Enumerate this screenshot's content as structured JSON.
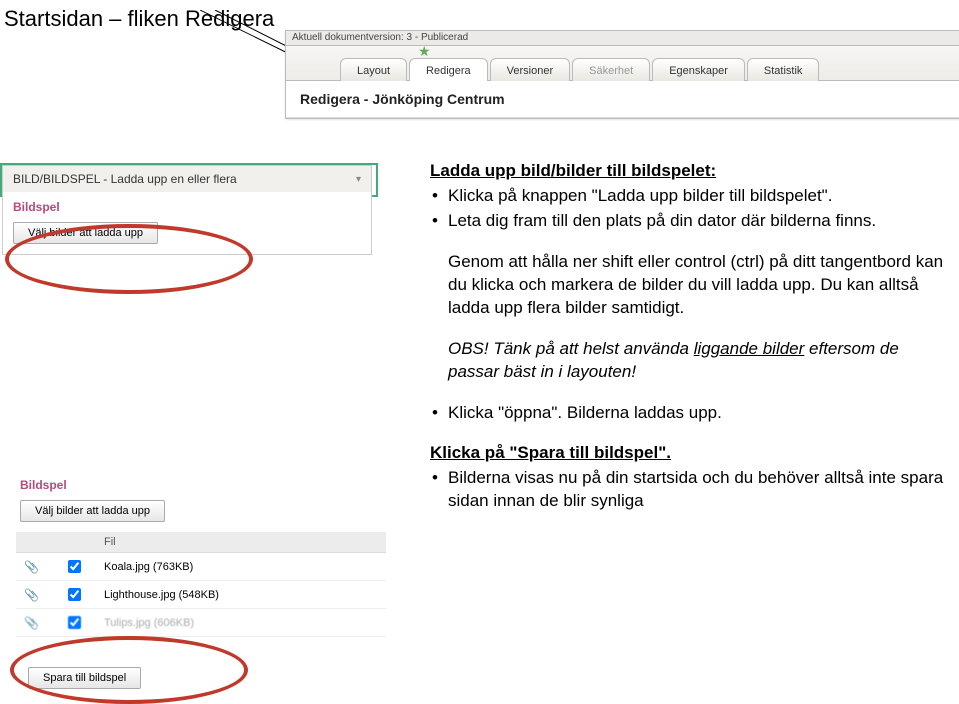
{
  "page_title": "Startsidan – fliken Redigera",
  "top_bar": {
    "doc_version": "Aktuell dokumentversion:  3  -  Publicerad",
    "tabs": [
      "Layout",
      "Redigera",
      "Versioner",
      "Säkerhet",
      "Egenskaper",
      "Statistik"
    ],
    "edit_header": "Redigera - Jönköping Centrum"
  },
  "panel1": {
    "title": "BILD/BILDSPEL - Ladda upp en eller flera",
    "subheading": "Bildspel",
    "upload_btn": "Välj bilder att ladda upp"
  },
  "panel2": {
    "subheading": "Bildspel",
    "upload_btn": "Välj bilder att ladda upp",
    "columns": {
      "c1": "",
      "c2": "",
      "c3": "Fil"
    },
    "rows": [
      {
        "file": "Koala.jpg (763KB)",
        "checked": true,
        "blurred": false
      },
      {
        "file": "Lighthouse.jpg (548KB)",
        "checked": true,
        "blurred": false
      },
      {
        "file": "Tulips.jpg (606KB)",
        "checked": true,
        "blurred": true
      }
    ],
    "save_btn": "Spara till bildspel"
  },
  "instructions": {
    "heading1": "Ladda upp bild/bilder till bildspelet:",
    "b1": "Klicka på knappen \"Ladda upp bilder till bildspelet\".",
    "b2": "Leta dig fram till den plats på din dator där bilderna finns.",
    "p1": "Genom att hålla ner shift eller control (ctrl) på ditt tangentbord kan du klicka och markera de bilder du vill ladda upp. Du kan alltså ladda upp flera bilder samtidigt.",
    "p2_pre": "OBS! Tänk på att helst använda ",
    "p2_u": "liggande bilder",
    "p2_post": " eftersom de passar bäst in i layouten!",
    "b3": "Klicka \"öppna\". Bilderna laddas upp.",
    "heading2": "Klicka på \"Spara till bildspel\".",
    "b4": "Bilderna visas nu på din startsida och du behöver alltså inte spara sidan innan de blir synliga"
  }
}
